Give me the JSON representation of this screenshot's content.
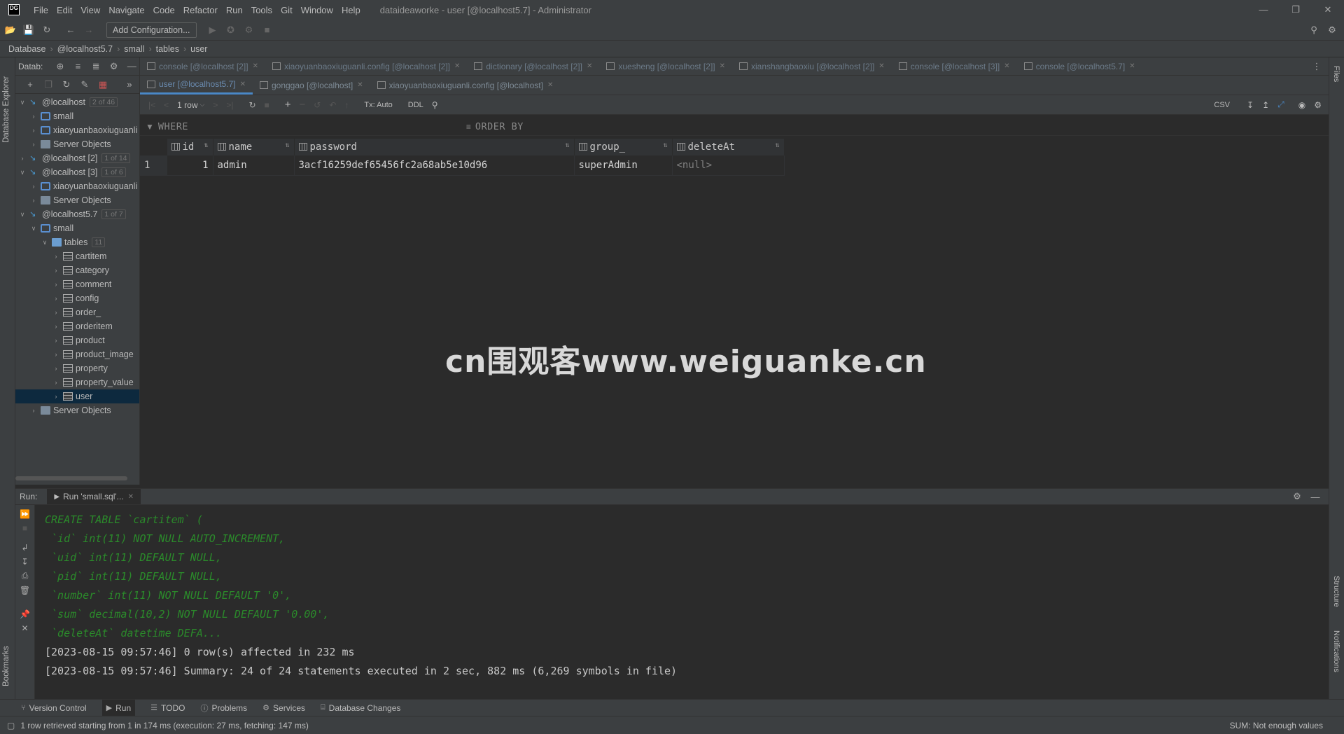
{
  "app": {
    "logo": "DG",
    "menu": [
      "File",
      "Edit",
      "View",
      "Navigate",
      "Code",
      "Refactor",
      "Run",
      "Tools",
      "Git",
      "Window",
      "Help"
    ],
    "window_title": "dataideaworke - user [@localhost5.7] - Administrator"
  },
  "toolbar": {
    "add_config": "Add Configuration..."
  },
  "breadcrumb": [
    "Database",
    "@localhost5.7",
    "small",
    "tables",
    "user"
  ],
  "left_stripe": {
    "db_explorer": "Database Explorer",
    "bookmarks": "Bookmarks"
  },
  "right_stripe": {
    "files": "Files",
    "structure": "Structure",
    "notifications": "Notifications"
  },
  "db_panel": {
    "title": "Datab:",
    "tree": [
      {
        "indent": 0,
        "arrow": "v",
        "icon": "db",
        "label": "@localhost",
        "meta": "2 of 46"
      },
      {
        "indent": 1,
        "arrow": ">",
        "icon": "schema",
        "label": "small",
        "meta": ""
      },
      {
        "indent": 1,
        "arrow": ">",
        "icon": "schema",
        "label": "xiaoyuanbaoxiuguanli",
        "meta": ""
      },
      {
        "indent": 1,
        "arrow": ">",
        "icon": "server",
        "label": "Server Objects",
        "meta": ""
      },
      {
        "indent": 0,
        "arrow": ">",
        "icon": "db",
        "label": "@localhost [2]",
        "meta": "1 of 14"
      },
      {
        "indent": 0,
        "arrow": "v",
        "icon": "db",
        "label": "@localhost [3]",
        "meta": "1 of 6"
      },
      {
        "indent": 1,
        "arrow": ">",
        "icon": "schema",
        "label": "xiaoyuanbaoxiuguanli",
        "meta": ""
      },
      {
        "indent": 1,
        "arrow": ">",
        "icon": "server",
        "label": "Server Objects",
        "meta": ""
      },
      {
        "indent": 0,
        "arrow": "v",
        "icon": "db",
        "label": "@localhost5.7",
        "meta": "1 of 7"
      },
      {
        "indent": 1,
        "arrow": "v",
        "icon": "schema",
        "label": "small",
        "meta": ""
      },
      {
        "indent": 2,
        "arrow": "v",
        "icon": "folder",
        "label": "tables",
        "meta": "11"
      },
      {
        "indent": 3,
        "arrow": ">",
        "icon": "table",
        "label": "cartitem",
        "meta": ""
      },
      {
        "indent": 3,
        "arrow": ">",
        "icon": "table",
        "label": "category",
        "meta": ""
      },
      {
        "indent": 3,
        "arrow": ">",
        "icon": "table",
        "label": "comment",
        "meta": ""
      },
      {
        "indent": 3,
        "arrow": ">",
        "icon": "table",
        "label": "config",
        "meta": ""
      },
      {
        "indent": 3,
        "arrow": ">",
        "icon": "table",
        "label": "order_",
        "meta": ""
      },
      {
        "indent": 3,
        "arrow": ">",
        "icon": "table",
        "label": "orderitem",
        "meta": ""
      },
      {
        "indent": 3,
        "arrow": ">",
        "icon": "table",
        "label": "product",
        "meta": ""
      },
      {
        "indent": 3,
        "arrow": ">",
        "icon": "table",
        "label": "product_image",
        "meta": ""
      },
      {
        "indent": 3,
        "arrow": ">",
        "icon": "table",
        "label": "property",
        "meta": ""
      },
      {
        "indent": 3,
        "arrow": ">",
        "icon": "table",
        "label": "property_value",
        "meta": ""
      },
      {
        "indent": 3,
        "arrow": ">",
        "icon": "table",
        "label": "user",
        "meta": "",
        "selected": true
      },
      {
        "indent": 1,
        "arrow": ">",
        "icon": "server",
        "label": "Server Objects",
        "meta": ""
      }
    ]
  },
  "tabs_row1": [
    "console [@localhost [2]]",
    "xiaoyuanbaoxiuguanli.config [@localhost [2]]",
    "dictionary [@localhost [2]]",
    "xuesheng [@localhost [2]]",
    "xianshangbaoxiu [@localhost [2]]",
    "console [@localhost [3]]",
    "console [@localhost5.7]"
  ],
  "tabs_row2": [
    {
      "label": "user [@localhost5.7]",
      "active": true
    },
    {
      "label": "gonggao [@localhost]",
      "active": false
    },
    {
      "label": "xiaoyuanbaoxiuguanli.config [@localhost]",
      "active": false
    }
  ],
  "grid_toolbar": {
    "rows": "1 row",
    "tx": "Tx: Auto",
    "ddl": "DDL",
    "export": "CSV"
  },
  "filter": {
    "where": "WHERE",
    "order_by": "ORDER BY"
  },
  "grid": {
    "columns": [
      "id",
      "name",
      "password",
      "group_",
      "deleteAt"
    ],
    "rows": [
      {
        "rownum": "1",
        "id": "1",
        "name": "admin",
        "password": "3acf16259def65456fc2a68ab5e10d96",
        "group_": "superAdmin",
        "deleteAt": "<null>"
      }
    ]
  },
  "watermark": "cn围观客www.weiguanke.cn",
  "run": {
    "label": "Run:",
    "tab": "Run 'small.sql'...",
    "lines": [
      {
        "type": "sql",
        "text": "CREATE TABLE `cartitem` ("
      },
      {
        "type": "sql",
        "text": " `id` int(11) NOT NULL AUTO_INCREMENT,"
      },
      {
        "type": "sql",
        "text": " `uid` int(11) DEFAULT NULL,"
      },
      {
        "type": "sql",
        "text": " `pid` int(11) DEFAULT NULL,"
      },
      {
        "type": "sql",
        "text": " `number` int(11) NOT NULL DEFAULT '0',"
      },
      {
        "type": "sql",
        "text": " `sum` decimal(10,2) NOT NULL DEFAULT '0.00',"
      },
      {
        "type": "sql",
        "text": " `deleteAt` datetime DEFA..."
      },
      {
        "type": "log",
        "text": "[2023-08-15 09:57:46] 0 row(s) affected in 232 ms"
      },
      {
        "type": "log",
        "text": "[2023-08-15 09:57:46] Summary: 24 of 24 statements executed in 2 sec, 882 ms (6,269 symbols in file)"
      }
    ]
  },
  "bottom_tools": [
    "Version Control",
    "Run",
    "TODO",
    "Problems",
    "Services",
    "Database Changes"
  ],
  "status": {
    "message": "1 row retrieved starting from 1 in 174 ms (execution: 27 ms, fetching: 147 ms)",
    "right": "SUM: Not enough values"
  }
}
